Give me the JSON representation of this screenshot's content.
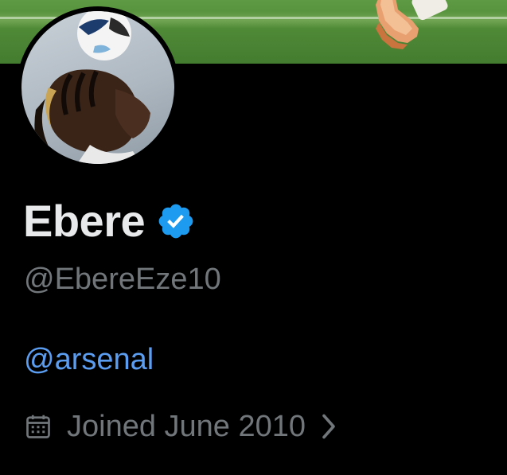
{
  "profile": {
    "display_name": "Ebere",
    "handle": "@EbereEze10",
    "bio_link": "@arsenal",
    "joined": "Joined June 2010"
  },
  "icons": {
    "verified": "verified-badge-icon",
    "calendar": "calendar-icon",
    "chevron": "chevron-right-icon"
  },
  "colors": {
    "background": "#000000",
    "name": "#e7e9ea",
    "secondary_text": "#71767b",
    "link": "#5b9df0",
    "verified": "#1d9bf0",
    "banner_grass": "#4f8a37"
  }
}
